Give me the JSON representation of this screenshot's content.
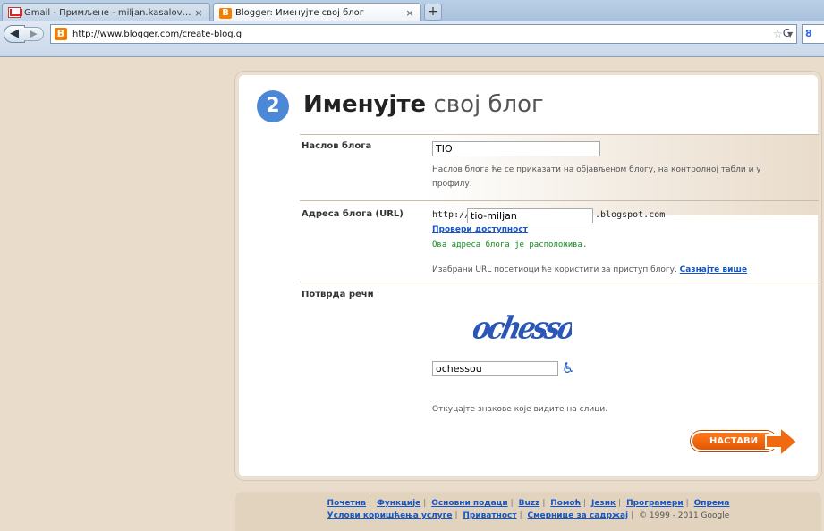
{
  "tabs": [
    {
      "label": "Gmail - Примљене - miljan.kasalovic@gm...",
      "icon": "gmail-icon"
    },
    {
      "label": "Blogger: Именујте свој блог",
      "icon": "blogger-icon"
    }
  ],
  "new_tab_label": "+",
  "nav": {
    "url": "http://www.blogger.com/create-blog.g",
    "back": "◀",
    "forward": "▶",
    "reload": "C",
    "search_logo": "8"
  },
  "page": {
    "step": "2",
    "title_bold": "Именујте",
    "title_rest": "свој блог",
    "blog_title_label": "Наслов блога",
    "blog_title_value": "TIO",
    "blog_title_help": "Наслов блога ће се приказати на објављеном блогу, на контролној табли и у профилу.",
    "address_label": "Адреса блога (URL)",
    "address_prefix": "http://",
    "address_value": "tio-miljan",
    "address_suffix": ".blogspot.com",
    "check_link": "Провери доступност",
    "available_msg": "Ова адреса блога је расположива.",
    "url_help": "Изабрани URL посетиоци ће користити за приступ блогу.",
    "learn_more": "Сазнајте више",
    "word_verify_label": "Потврда речи",
    "captcha_text": "ochessou",
    "captcha_value": "ochessou",
    "captcha_help": "Откуцајте знакове које видите на слици.",
    "continue_label": "НАСТАВИ"
  },
  "footer": {
    "links_row1": [
      "Почетна",
      "Функције",
      "Основни подаци",
      "Buzz",
      "Помоћ",
      "Језик",
      "Програмери",
      "Опрема"
    ],
    "links_row2": [
      "Услови коришћења услуге",
      "Приватност",
      "Смернице за садржај"
    ],
    "copyright": "© 1999 - 2011 Google"
  },
  "colors": {
    "accent": "#f57d00",
    "link": "#1556c7",
    "step_badge": "#4b89d8",
    "available": "#118a1c"
  }
}
